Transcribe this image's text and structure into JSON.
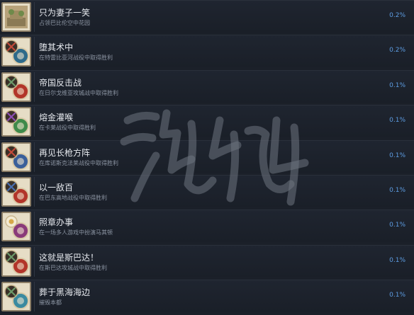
{
  "achievements": [
    {
      "title": "只为妻子一笑",
      "desc": "占领巴比伦空中花园",
      "pct": "0.2%",
      "icon": "hanging-gardens-icon",
      "badge": "#7f9f5a",
      "cross": ""
    },
    {
      "title": "堕其术中",
      "desc": "在特雷比亚河战役中取得胜利",
      "pct": "0.2%",
      "icon": "crossed-swords-moon-icon",
      "badge": "#2e6a8a",
      "cross": "#c24a3a"
    },
    {
      "title": "帝国反击战",
      "desc": "在日尔戈维亚攻城战中取得胜利",
      "pct": "0.1%",
      "icon": "crossed-swords-eagle-icon",
      "badge": "#b2352a",
      "cross": "#6d9a6a"
    },
    {
      "title": "熔金灌喉",
      "desc": "在卡莱战役中取得胜利",
      "pct": "0.1%",
      "icon": "crossed-swords-laurel-icon",
      "badge": "#3f8a4a",
      "cross": "#8d4fb5"
    },
    {
      "title": "再见长枪方阵",
      "desc": "在库诺斯克法莱战役中取得胜利",
      "pct": "0.1%",
      "icon": "crossed-swords-star-icon",
      "badge": "#3a5f9a",
      "cross": "#c24a3a"
    },
    {
      "title": "以一敌百",
      "desc": "在巴东高地战役中取得胜利",
      "pct": "0.1%",
      "icon": "crossed-swords-wolf-icon",
      "badge": "#b2352a",
      "cross": "#4a6fb0"
    },
    {
      "title": "照章办事",
      "desc": "在一场多人游戏中扮演马其顿",
      "pct": "0.1%",
      "icon": "macedon-sun-icon",
      "badge": "#8a3a7a",
      "cross": ""
    },
    {
      "title": "这就是斯巴达！",
      "desc": "在斯巴达攻城战中取得胜利",
      "pct": "0.1%",
      "icon": "crossed-swords-sparta-icon",
      "badge": "#b2352a",
      "cross": "#6d9a6a"
    },
    {
      "title": "葬于黑海海边",
      "desc": "摧毁本都",
      "pct": "0.1%",
      "icon": "crossed-spears-icon",
      "badge": "#3a8aa0",
      "cross": "#6d9a6a"
    }
  ],
  "watermark": {
    "text": "游侠网"
  }
}
